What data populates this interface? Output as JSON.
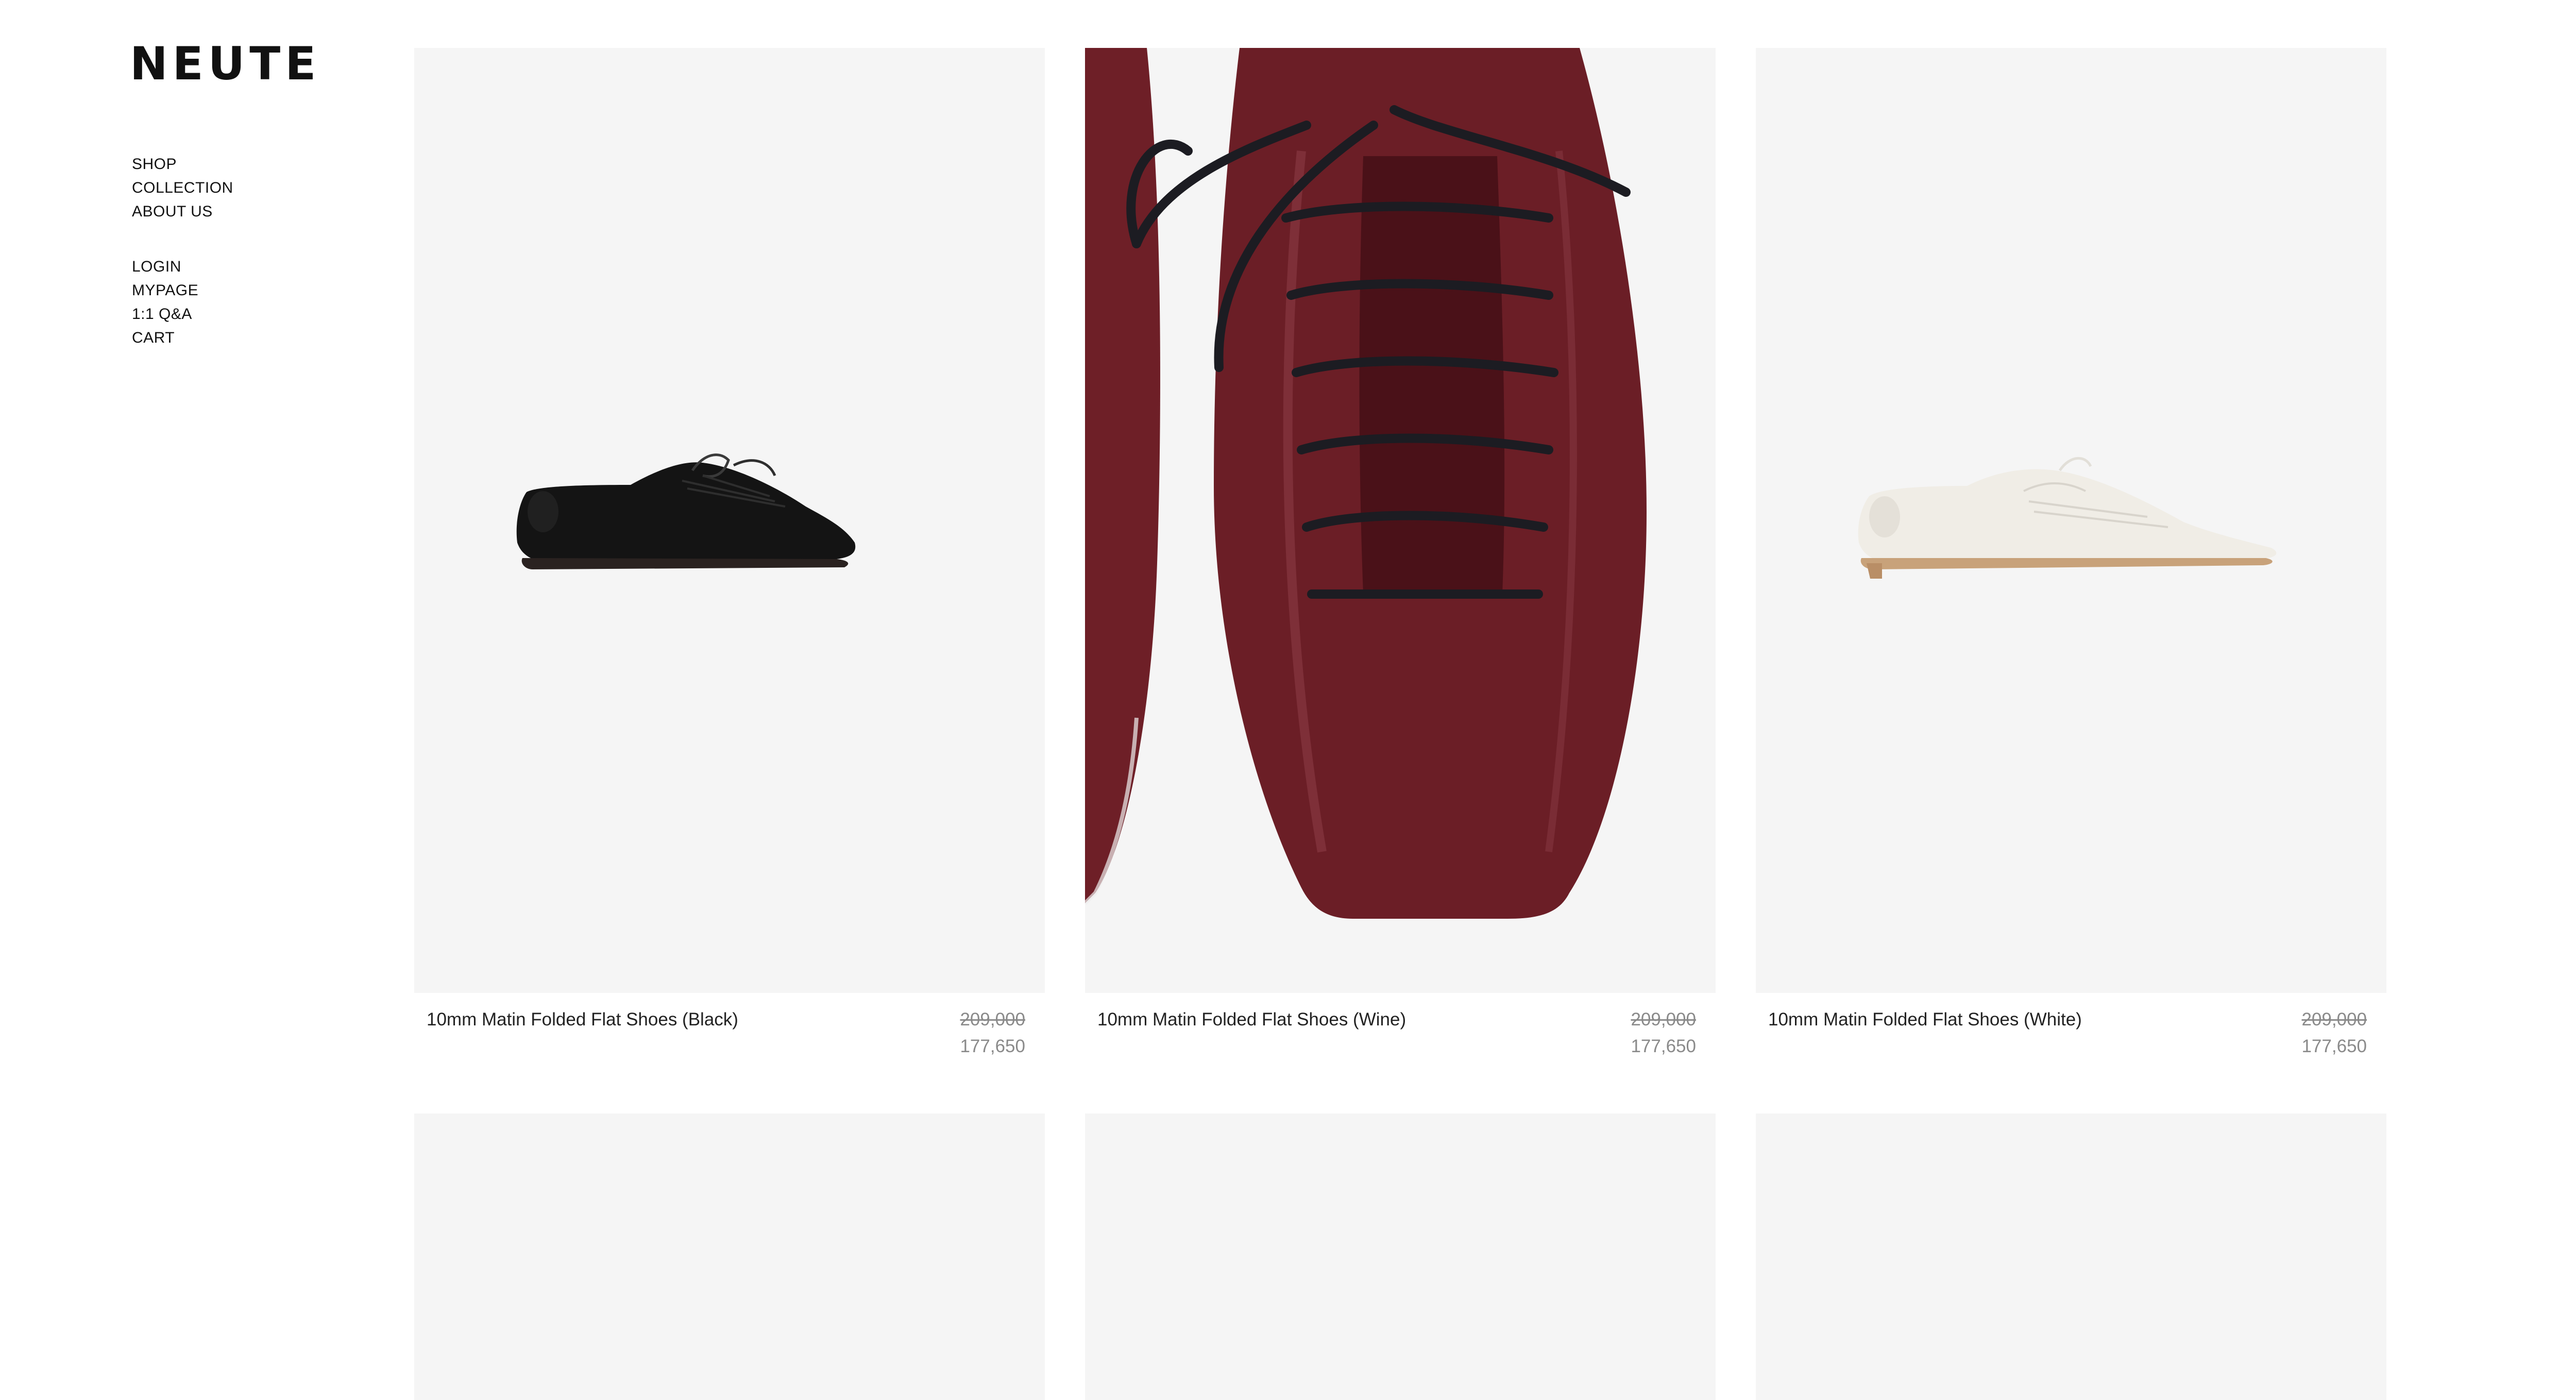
{
  "brand": {
    "logo": "NEUTE"
  },
  "nav": {
    "primary": [
      {
        "label": "SHOP"
      },
      {
        "label": "COLLECTION"
      },
      {
        "label": "ABOUT US"
      }
    ],
    "secondary": [
      {
        "label": "LOGIN"
      },
      {
        "label": "MYPAGE"
      },
      {
        "label": "1:1 Q&A"
      },
      {
        "label": "CART"
      }
    ]
  },
  "products": [
    {
      "name": "10mm Matin Folded Flat Shoes (Black)",
      "price_original": "209,000",
      "price_sale": "177,650",
      "color_hex": "#1a1a1a"
    },
    {
      "name": "10mm Matin Folded Flat Shoes (Wine)",
      "price_original": "209,000",
      "price_sale": "177,650",
      "color_hex": "#6b1e26"
    },
    {
      "name": "10mm Matin Folded Flat Shoes (White)",
      "price_original": "209,000",
      "price_sale": "177,650",
      "color_hex": "#f2efe8"
    }
  ],
  "scroll_top": {
    "icon": "arrow-up-icon",
    "glyph": "↑"
  },
  "colors": {
    "tile_background": "#f5f5f5",
    "price_gray": "#8a8a8a"
  }
}
